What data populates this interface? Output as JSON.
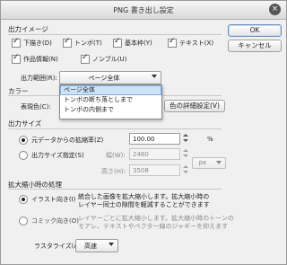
{
  "title": "PNG 書き出し設定",
  "buttons": {
    "ok": "OK",
    "cancel": "キャンセル",
    "color_detail": "色の詳細設定(V)"
  },
  "output_image": {
    "label": "出力イメージ",
    "checks": [
      {
        "label": "下描き(D)",
        "checked": true
      },
      {
        "label": "トンボ(T)",
        "checked": true
      },
      {
        "label": "基本枠(Y)",
        "checked": true
      },
      {
        "label": "テキスト(X)",
        "checked": true
      },
      {
        "label": "作品情報(N)",
        "checked": true
      },
      {
        "label": "ノンブル(U)",
        "checked": true
      }
    ],
    "range_label": "出力範囲(R):",
    "range_value": "ページ全体",
    "range_options": [
      "ページ全体",
      "トンボの断ち落としまで",
      "トンボの内側まで"
    ]
  },
  "color": {
    "label": "カラー",
    "expression_label": "表現色(C):"
  },
  "output_size": {
    "label": "出力サイズ",
    "scale_label": "元データからの拡縮率(Z)",
    "scale_value": "100.00",
    "scale_unit": "%",
    "specify_label": "出力サイズ指定(S)",
    "width_label": "幅(W):",
    "width_value": "2480",
    "height_label": "高さ(H):",
    "height_value": "3508",
    "unit_value": "px"
  },
  "scaling": {
    "label": "拡大縮小時の処理",
    "illust_label": "イラスト向き(I)",
    "illust_desc_1": "統合した画像を拡大縮小します。拡大縮小時の",
    "illust_desc_2": "レイヤー同士の隙間を軽減することができます",
    "comic_label": "コミック向き(O)",
    "comic_desc_1": "レイヤーごとに拡大縮小します。拡大縮小時のトーンの",
    "comic_desc_2": "モアレ、テキストやベクター線のジャギーを抑えます",
    "rasterize_label": "ラスタライズ(A):",
    "rasterize_value": "高速"
  }
}
